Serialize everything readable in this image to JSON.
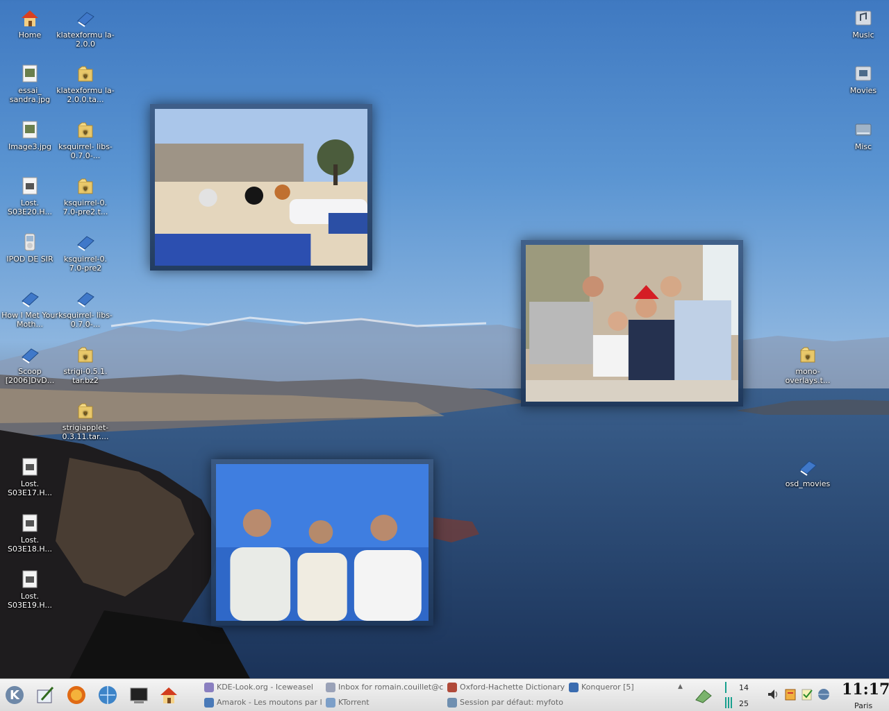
{
  "desktop_left_col1": [
    {
      "label": "Home",
      "icon": "home-icon"
    },
    {
      "label": "essai_ sandra.jpg",
      "icon": "image-file-icon"
    },
    {
      "label": "Image3.jpg",
      "icon": "image-file-icon"
    },
    {
      "label": "Lost. S03E20.H...",
      "icon": "video-file-icon"
    },
    {
      "label": "IPOD DE SIR",
      "icon": "ipod-icon"
    },
    {
      "label": "How I Met Your Moth...",
      "icon": "book-icon"
    },
    {
      "label": "Scoop [2006]DvD...",
      "icon": "book-icon"
    },
    {
      "label": "Lost. S03E17.H...",
      "icon": "video-file-icon"
    },
    {
      "label": "Lost. S03E18.H...",
      "icon": "video-file-icon"
    },
    {
      "label": "Lost. S03E19.H...",
      "icon": "video-file-icon"
    }
  ],
  "desktop_left_col2": [
    {
      "label": "klatexformu la-2.0.0",
      "icon": "book-icon"
    },
    {
      "label": "klatexformu la-2.0.0.ta...",
      "icon": "archive-icon"
    },
    {
      "label": "ksquirrel- libs-0.7.0-...",
      "icon": "archive-icon"
    },
    {
      "label": "ksquirrel-0. 7.0-pre2.t...",
      "icon": "archive-icon"
    },
    {
      "label": "ksquirrel-0. 7.0-pre2",
      "icon": "book-icon"
    },
    {
      "label": "ksquirrel- libs-0.7.0-...",
      "icon": "book-icon"
    },
    {
      "label": "strigi-0.5.1. tar.bz2",
      "icon": "archive-icon"
    },
    {
      "label": "strigiapplet- 0.3.11.tar....",
      "icon": "archive-icon"
    }
  ],
  "desktop_right": [
    {
      "label": "Music",
      "icon": "music-drive-icon"
    },
    {
      "label": "Movies",
      "icon": "movies-drive-icon"
    },
    {
      "label": "Misc",
      "icon": "drive-icon"
    },
    {
      "label": "mono- overlays.t...",
      "icon": "archive-icon"
    },
    {
      "label": "osd_movies",
      "icon": "book-icon"
    }
  ],
  "photos": [
    {
      "name": "beach-photo"
    },
    {
      "name": "party-photo"
    },
    {
      "name": "friends-photo"
    }
  ],
  "taskbar": {
    "launchers": [
      "kde-menu-icon",
      "kate-icon",
      "firefox-icon",
      "web-browser-icon",
      "terminal-icon",
      "home-folder-icon"
    ],
    "tasks": [
      {
        "label": "KDE-Look.org - Iceweasel",
        "icon": "iceweasel-icon",
        "color": "#8a7fc0"
      },
      {
        "label": "Inbox for romain.couillet@c",
        "icon": "mail-icon",
        "color": "#9aa2b8"
      },
      {
        "label": "Oxford-Hachette Dictionary",
        "icon": "dictionary-icon",
        "color": "#b04a3a"
      },
      {
        "label": "Konqueror [5]",
        "icon": "konqueror-icon",
        "color": "#3a6cb0"
      },
      {
        "label": "Amarok - Les moutons par l",
        "icon": "amarok-icon",
        "color": "#4a7ab8"
      },
      {
        "label": "KTorrent",
        "icon": "ktorrent-icon",
        "color": "#7c9fc8"
      },
      {
        "label": "Session par défaut: myfoto",
        "icon": "session-icon",
        "color": "#6f8fb0"
      }
    ],
    "pager": {
      "top": "14",
      "bottom": "25"
    },
    "clock": {
      "time": "11:17",
      "city": "Paris"
    },
    "tray": [
      "volume-icon",
      "klipper-icon",
      "notes-icon",
      "network-icon"
    ]
  }
}
